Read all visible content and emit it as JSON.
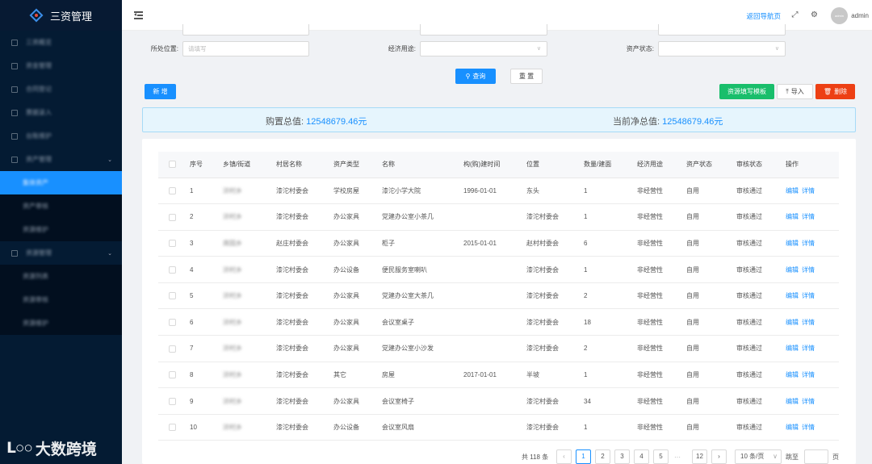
{
  "app": {
    "title": "三资管理"
  },
  "sidebar": {
    "items": [
      {
        "label": "三资概览",
        "type": "item"
      },
      {
        "label": "资金管理",
        "type": "item"
      },
      {
        "label": "合同登记",
        "type": "item"
      },
      {
        "label": "票据录入",
        "type": "item"
      },
      {
        "label": "台账维护",
        "type": "item"
      },
      {
        "label": "资产管理",
        "type": "parent"
      },
      {
        "label": "集体资产",
        "type": "sub",
        "active": true
      },
      {
        "label": "资产审核",
        "type": "sub"
      },
      {
        "label": "资源维护",
        "type": "sub"
      },
      {
        "label": "资源管理",
        "type": "parent"
      },
      {
        "label": "资源列表",
        "type": "sub"
      },
      {
        "label": "资源审核",
        "type": "sub"
      },
      {
        "label": "资源维护",
        "type": "sub"
      }
    ]
  },
  "watermark": {
    "logo": "ᒪ○○",
    "text": "大数跨境"
  },
  "header": {
    "back_link": "返回导航页",
    "avatar_text": "admin",
    "user_name": "admin"
  },
  "filters": {
    "location_label": "所处位置:",
    "location_placeholder": "请填写",
    "econ_use_label": "经济用途:",
    "econ_use_value": "",
    "asset_status_label": "资产状态:",
    "asset_status_value": ""
  },
  "buttons": {
    "query": "查询",
    "reset": "重 置",
    "add": "新 增",
    "template": "资源填写模板",
    "import": "导入",
    "delete": "删除"
  },
  "summary": {
    "purchase_label": "购置总值:",
    "purchase_value": "12548679.46元",
    "net_label": "当前净总值:",
    "net_value": "12548679.46元"
  },
  "table": {
    "columns": [
      "序号",
      "乡镇/街道",
      "村居名称",
      "资产类型",
      "名称",
      "构(购)建时间",
      "位置",
      "数量/建面",
      "经济用途",
      "资产状态",
      "审核状态",
      "操作"
    ],
    "rows": [
      {
        "no": "1",
        "town": "浒村乡",
        "village": "漆沱村委会",
        "type": "学校房屋",
        "name": "漆沱小学大院",
        "date": "1996-01-01",
        "loc": "东头",
        "qty": "1",
        "use": "非经营性",
        "status": "自用",
        "audit": "审核通过"
      },
      {
        "no": "2",
        "town": "浒村乡",
        "village": "漆沱村委会",
        "type": "办公家具",
        "name": "党建办公室小茶几",
        "date": "",
        "loc": "漆沱村委会",
        "qty": "1",
        "use": "非经营性",
        "status": "自用",
        "audit": "审核通过"
      },
      {
        "no": "3",
        "town": "席园乡",
        "village": "赵庄村委会",
        "type": "办公家具",
        "name": "柜子",
        "date": "2015-01-01",
        "loc": "赵村村委会",
        "qty": "6",
        "use": "非经营性",
        "status": "自用",
        "audit": "审核通过"
      },
      {
        "no": "4",
        "town": "浒村乡",
        "village": "漆沱村委会",
        "type": "办公设备",
        "name": "便民服务室喇叭",
        "date": "",
        "loc": "漆沱村委会",
        "qty": "1",
        "use": "非经营性",
        "status": "自用",
        "audit": "审核通过"
      },
      {
        "no": "5",
        "town": "浒村乡",
        "village": "漆沱村委会",
        "type": "办公家具",
        "name": "党建办公室大茶几",
        "date": "",
        "loc": "漆沱村委会",
        "qty": "2",
        "use": "非经营性",
        "status": "自用",
        "audit": "审核通过"
      },
      {
        "no": "6",
        "town": "浒村乡",
        "village": "漆沱村委会",
        "type": "办公家具",
        "name": "会议室桌子",
        "date": "",
        "loc": "漆沱村委会",
        "qty": "18",
        "use": "非经营性",
        "status": "自用",
        "audit": "审核通过"
      },
      {
        "no": "7",
        "town": "浒村乡",
        "village": "漆沱村委会",
        "type": "办公家具",
        "name": "党建办公室小沙发",
        "date": "",
        "loc": "漆沱村委会",
        "qty": "2",
        "use": "非经营性",
        "status": "自用",
        "audit": "审核通过"
      },
      {
        "no": "8",
        "town": "浒村乡",
        "village": "漆沱村委会",
        "type": "其它",
        "name": "房屋",
        "date": "2017-01-01",
        "loc": "半坡",
        "qty": "1",
        "use": "非经营性",
        "status": "自用",
        "audit": "审核通过"
      },
      {
        "no": "9",
        "town": "浒村乡",
        "village": "漆沱村委会",
        "type": "办公家具",
        "name": "会议室椅子",
        "date": "",
        "loc": "漆沱村委会",
        "qty": "34",
        "use": "非经营性",
        "status": "自用",
        "audit": "审核通过"
      },
      {
        "no": "10",
        "town": "浒村乡",
        "village": "漆沱村委会",
        "type": "办公设备",
        "name": "会议室风扇",
        "date": "",
        "loc": "漆沱村委会",
        "qty": "1",
        "use": "非经营性",
        "status": "自用",
        "audit": "审核通过"
      }
    ],
    "op_edit": "编辑",
    "op_detail": "详情"
  },
  "pagination": {
    "total_text": "共 118 条",
    "pages": [
      "1",
      "2",
      "3",
      "4",
      "5"
    ],
    "ellipsis": "···",
    "last_page": "12",
    "current": "1",
    "page_size": "10 条/页",
    "jump_label": "跳至",
    "page_suffix": "页"
  }
}
